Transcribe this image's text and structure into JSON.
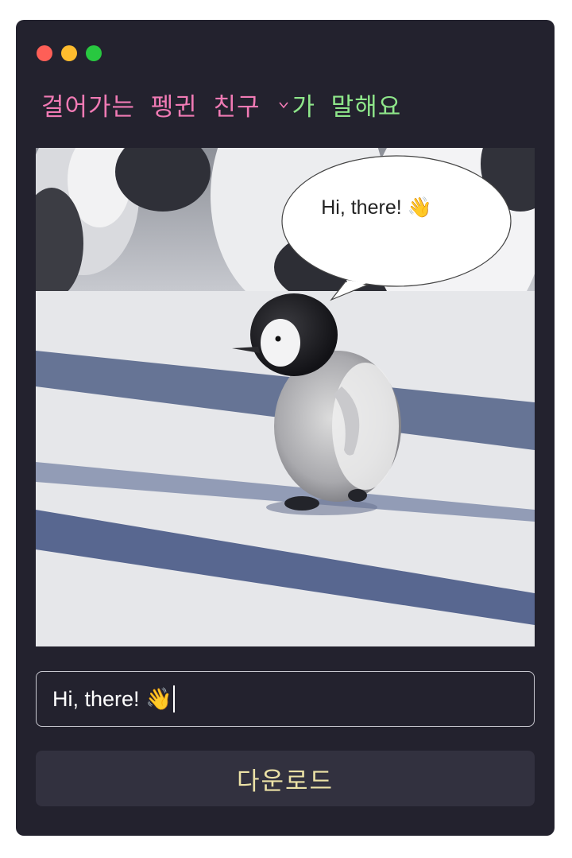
{
  "window": {
    "traffic_lights": [
      "#fe5f57",
      "#febc2e",
      "#28c840"
    ]
  },
  "header": {
    "title_pink": "걸어가는 펭귄 친구",
    "title_green": "가 말해요",
    "chevron_icon": "chevron-down-icon",
    "colors": {
      "pink": "#f07ab4",
      "green": "#8ee68a"
    }
  },
  "photo": {
    "speech_bubble_text": "Hi, there! 👋"
  },
  "message_input": {
    "value": "Hi, there! 👋"
  },
  "download_button": {
    "label": "다운로드",
    "text_color": "#ece2a6"
  }
}
